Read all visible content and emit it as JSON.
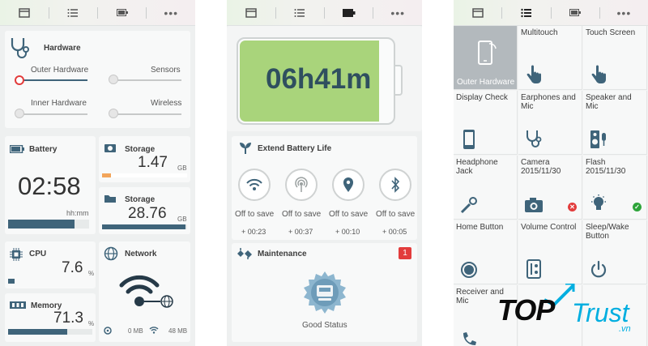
{
  "screen1": {
    "hardware": {
      "title": "Hardware",
      "outer": "Outer Hardware",
      "sensors": "Sensors",
      "inner": "Inner Hardware",
      "wireless": "Wireless"
    },
    "battery": {
      "title": "Battery",
      "time": "02:58",
      "unit": "hh:mm",
      "level": 0.82
    },
    "storage1": {
      "title": "Storage",
      "value": "1.47",
      "unit": "GB",
      "level": 0.1
    },
    "storage2": {
      "title": "Storage",
      "value": "28.76",
      "unit": "GB",
      "level": 0.98
    },
    "cpu": {
      "title": "CPU",
      "value": "7.6",
      "unit": "%",
      "level": 0.08
    },
    "memory": {
      "title": "Memory",
      "value": "71.3",
      "unit": "%",
      "level": 0.7
    },
    "network": {
      "title": "Network",
      "down": "0 MB",
      "wifi": "48 MB"
    }
  },
  "screen2": {
    "battery_time": "06h41m",
    "extend_title": "Extend Battery Life",
    "options": [
      {
        "icon": "wifi-icon",
        "label": "Off to save",
        "gain": "+ 00:23"
      },
      {
        "icon": "hotspot-icon",
        "label": "Off to save",
        "gain": "+ 00:37"
      },
      {
        "icon": "location-icon",
        "label": "Off to save",
        "gain": "+ 00:10"
      },
      {
        "icon": "bluetooth-icon",
        "label": "Off to save",
        "gain": "+ 00:05"
      }
    ],
    "maintenance": {
      "title": "Maintenance",
      "badge": "1",
      "status": "Good Status"
    }
  },
  "screen3": {
    "cells": [
      {
        "label": "Outer Hardware",
        "selected": true
      },
      {
        "label": "Multitouch"
      },
      {
        "label": "Touch Screen"
      },
      {
        "label": "Display Check"
      },
      {
        "label": "Earphones and\nMic"
      },
      {
        "label": "Speaker and Mic"
      },
      {
        "label": "Headphone Jack"
      },
      {
        "label": "Camera\n2015/11/30"
      },
      {
        "label": "Flash\n2015/11/30"
      },
      {
        "label": "Home Button"
      },
      {
        "label": "Volume Control"
      },
      {
        "label": "Sleep/Wake\nButton"
      },
      {
        "label": "Receiver and Mic"
      },
      {
        "label": ""
      },
      {
        "label": ""
      }
    ]
  },
  "watermark": {
    "text1": "TOP",
    "text2": "Trust",
    "suffix": ".vn"
  },
  "colors": {
    "accent": "#3f647a",
    "battery_green": "#a9d47b",
    "storage_orange": "#f2a55a",
    "error": "#e23c3c",
    "ok": "#2ea43a"
  }
}
